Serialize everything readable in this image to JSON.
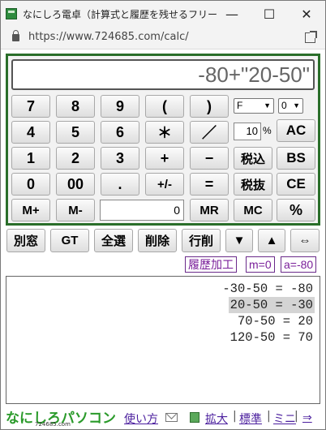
{
  "window": {
    "title": "なにしろ電卓（計算式と履歴を残せるフリーのウ…",
    "minimize": "—",
    "maximize": "☐",
    "close": "✕"
  },
  "browser": {
    "url": "https://www.724685.com/calc/"
  },
  "calculator": {
    "display": "-80+\"20-50\"",
    "rows": [
      [
        "7",
        "8",
        "9",
        "(",
        ")"
      ],
      [
        "4",
        "5",
        "6",
        "＊",
        "／"
      ],
      [
        "1",
        "2",
        "3",
        "+",
        "−"
      ],
      [
        "0",
        "00",
        ".",
        "+/-",
        "="
      ]
    ],
    "mem_row": {
      "mplus": "M+",
      "mminus": "M-",
      "memory_value": "0",
      "mr": "MR",
      "mc": "MC",
      "percent": "%"
    },
    "format_select": "F",
    "decimal_select": "0",
    "tax_rate": "10",
    "tax_rate_unit": "%",
    "side_keys": {
      "ac": "AC",
      "tax_in": "税込",
      "bs": "BS",
      "tax_out": "税抜",
      "ce": "CE"
    }
  },
  "toolbar": {
    "buttons": [
      "別窓",
      "GT",
      "全選",
      "削除",
      "行削",
      "▼",
      "▲",
      "⇔"
    ]
  },
  "tags": {
    "history_edit": "履歴加工",
    "m_value": "m=0",
    "a_value": "a=-80"
  },
  "history": {
    "lines": [
      "-30-50 = -80",
      "20-50 = -30",
      "70-50 = 20",
      "120-50 = 70"
    ],
    "selected_index": 1
  },
  "footer": {
    "logo": "なにしろパソコン",
    "logo_sub": "724685.com",
    "links": {
      "usage": "使い方",
      "enlarge": "拡大",
      "standard": "標準",
      "mini": "ミニ",
      "arrow": "⇒"
    }
  }
}
